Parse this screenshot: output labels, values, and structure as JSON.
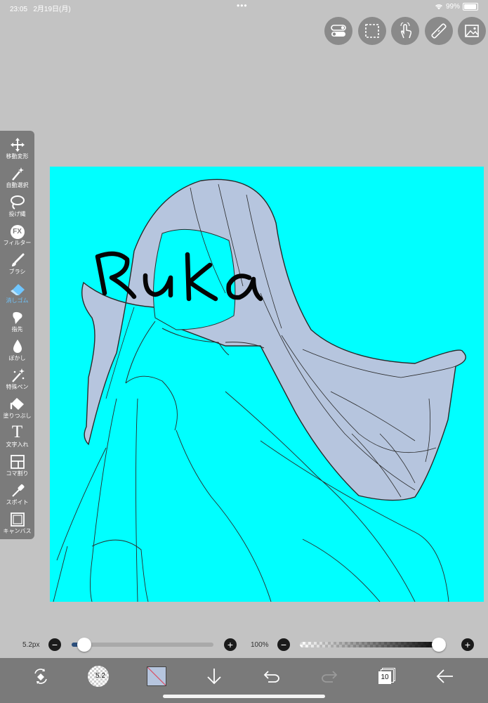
{
  "status_bar": {
    "time": "23:05",
    "date": "2月19日(月)",
    "battery": "99%"
  },
  "toolbar": {
    "tools": [
      {
        "label": "移動変形",
        "icon": "move-icon"
      },
      {
        "label": "自動選択",
        "icon": "magic-wand-icon"
      },
      {
        "label": "投げ縄",
        "icon": "lasso-icon"
      },
      {
        "label": "フィルター",
        "icon": "fx-icon"
      },
      {
        "label": "ブラシ",
        "icon": "brush-icon"
      },
      {
        "label": "消しゴム",
        "icon": "eraser-icon"
      },
      {
        "label": "指先",
        "icon": "finger-icon"
      },
      {
        "label": "ぼかし",
        "icon": "blur-icon"
      },
      {
        "label": "特殊ペン",
        "icon": "special-pen-icon"
      },
      {
        "label": "塗りつぶし",
        "icon": "fill-icon"
      },
      {
        "label": "文字入れ",
        "icon": "text-icon"
      },
      {
        "label": "コマ割り",
        "icon": "frame-divider-icon"
      },
      {
        "label": "スポイト",
        "icon": "eyedropper-icon"
      },
      {
        "label": "キャンバス",
        "icon": "canvas-icon"
      }
    ],
    "active_tool": "消しゴム",
    "fx_text": "FX",
    "text_tool_glyph": "T"
  },
  "top_buttons": [
    "settings-toggle-icon",
    "selection-icon",
    "touch-icon",
    "ruler-icon",
    "image-icon"
  ],
  "canvas": {
    "background": "#00ffff",
    "drawn_text": "Ruka"
  },
  "brush_size": {
    "value": "5.2px",
    "level": 0.07,
    "minus": "−",
    "plus": "+"
  },
  "opacity": {
    "value": "100%",
    "level": 1.0,
    "minus": "−",
    "plus": "+"
  },
  "bottom_bar": {
    "brush_badge": "5.2",
    "layer_count": "10"
  }
}
